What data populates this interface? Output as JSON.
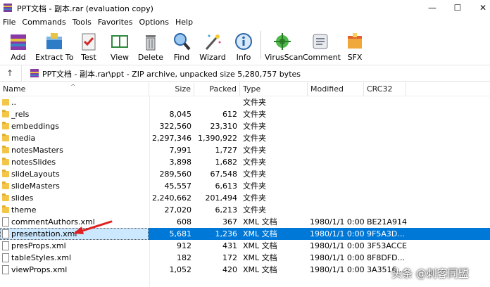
{
  "window": {
    "title": "PPT文档 - 副本.rar (evaluation copy)",
    "controls": {
      "minimize": "—",
      "maximize": "☐",
      "close": "✕"
    }
  },
  "menu": [
    "File",
    "Commands",
    "Tools",
    "Favorites",
    "Options",
    "Help"
  ],
  "toolbar": [
    {
      "label": "Add",
      "icon": "add-archive-icon"
    },
    {
      "label": "Extract To",
      "icon": "extract-to-icon"
    },
    {
      "label": "Test",
      "icon": "test-icon"
    },
    {
      "label": "View",
      "icon": "view-icon"
    },
    {
      "label": "Delete",
      "icon": "delete-icon"
    },
    {
      "label": "Find",
      "icon": "find-icon"
    },
    {
      "label": "Wizard",
      "icon": "wizard-icon"
    },
    {
      "label": "Info",
      "icon": "info-icon"
    },
    {
      "label": "VirusScan",
      "icon": "virus-scan-icon"
    },
    {
      "label": "Comment",
      "icon": "comment-icon"
    },
    {
      "label": "SFX",
      "icon": "sfx-icon"
    }
  ],
  "path": {
    "up_glyph": "↑",
    "text": "PPT文档 - 副本.rar\\ppt - ZIP archive, unpacked size 5,280,757 bytes"
  },
  "columns": {
    "name": "Name",
    "size": "Size",
    "packed": "Packed",
    "type": "Type",
    "modified": "Modified",
    "crc": "CRC32"
  },
  "rows": [
    {
      "kind": "updir",
      "name": "..",
      "size": "",
      "packed": "",
      "type": "文件夹",
      "modified": "",
      "crc": ""
    },
    {
      "kind": "folder",
      "name": "_rels",
      "size": "8,045",
      "packed": "612",
      "type": "文件夹",
      "modified": "",
      "crc": ""
    },
    {
      "kind": "folder",
      "name": "embeddings",
      "size": "322,560",
      "packed": "23,310",
      "type": "文件夹",
      "modified": "",
      "crc": ""
    },
    {
      "kind": "folder",
      "name": "media",
      "size": "2,297,346",
      "packed": "1,390,922",
      "type": "文件夹",
      "modified": "",
      "crc": ""
    },
    {
      "kind": "folder",
      "name": "notesMasters",
      "size": "7,991",
      "packed": "1,727",
      "type": "文件夹",
      "modified": "",
      "crc": ""
    },
    {
      "kind": "folder",
      "name": "notesSlides",
      "size": "3,898",
      "packed": "1,682",
      "type": "文件夹",
      "modified": "",
      "crc": ""
    },
    {
      "kind": "folder",
      "name": "slideLayouts",
      "size": "289,560",
      "packed": "67,548",
      "type": "文件夹",
      "modified": "",
      "crc": ""
    },
    {
      "kind": "folder",
      "name": "slideMasters",
      "size": "45,557",
      "packed": "6,613",
      "type": "文件夹",
      "modified": "",
      "crc": ""
    },
    {
      "kind": "folder",
      "name": "slides",
      "size": "2,240,662",
      "packed": "201,494",
      "type": "文件夹",
      "modified": "",
      "crc": ""
    },
    {
      "kind": "folder",
      "name": "theme",
      "size": "27,020",
      "packed": "6,213",
      "type": "文件夹",
      "modified": "",
      "crc": ""
    },
    {
      "kind": "file",
      "name": "commentAuthors.xml",
      "size": "608",
      "packed": "367",
      "type": "XML 文档",
      "modified": "1980/1/1 0:00",
      "crc": "BE21A914"
    },
    {
      "kind": "file",
      "name": "presentation.xml",
      "size": "5,681",
      "packed": "1,236",
      "type": "XML 文档",
      "modified": "1980/1/1 0:00",
      "crc": "9F5A3D...",
      "selected": true
    },
    {
      "kind": "file",
      "name": "presProps.xml",
      "size": "912",
      "packed": "431",
      "type": "XML 文档",
      "modified": "1980/1/1 0:00",
      "crc": "3F53ACCE"
    },
    {
      "kind": "file",
      "name": "tableStyles.xml",
      "size": "182",
      "packed": "172",
      "type": "XML 文档",
      "modified": "1980/1/1 0:00",
      "crc": "8F8DFD..."
    },
    {
      "kind": "file",
      "name": "viewProps.xml",
      "size": "1,052",
      "packed": "420",
      "type": "XML 文档",
      "modified": "1980/1/1 0:00",
      "crc": "3A3516..."
    }
  ],
  "watermark": "头条 @刺客同盟",
  "colors": {
    "selection": "#0078d7",
    "arrow": "#e02020",
    "folder": "#f3c64a"
  }
}
